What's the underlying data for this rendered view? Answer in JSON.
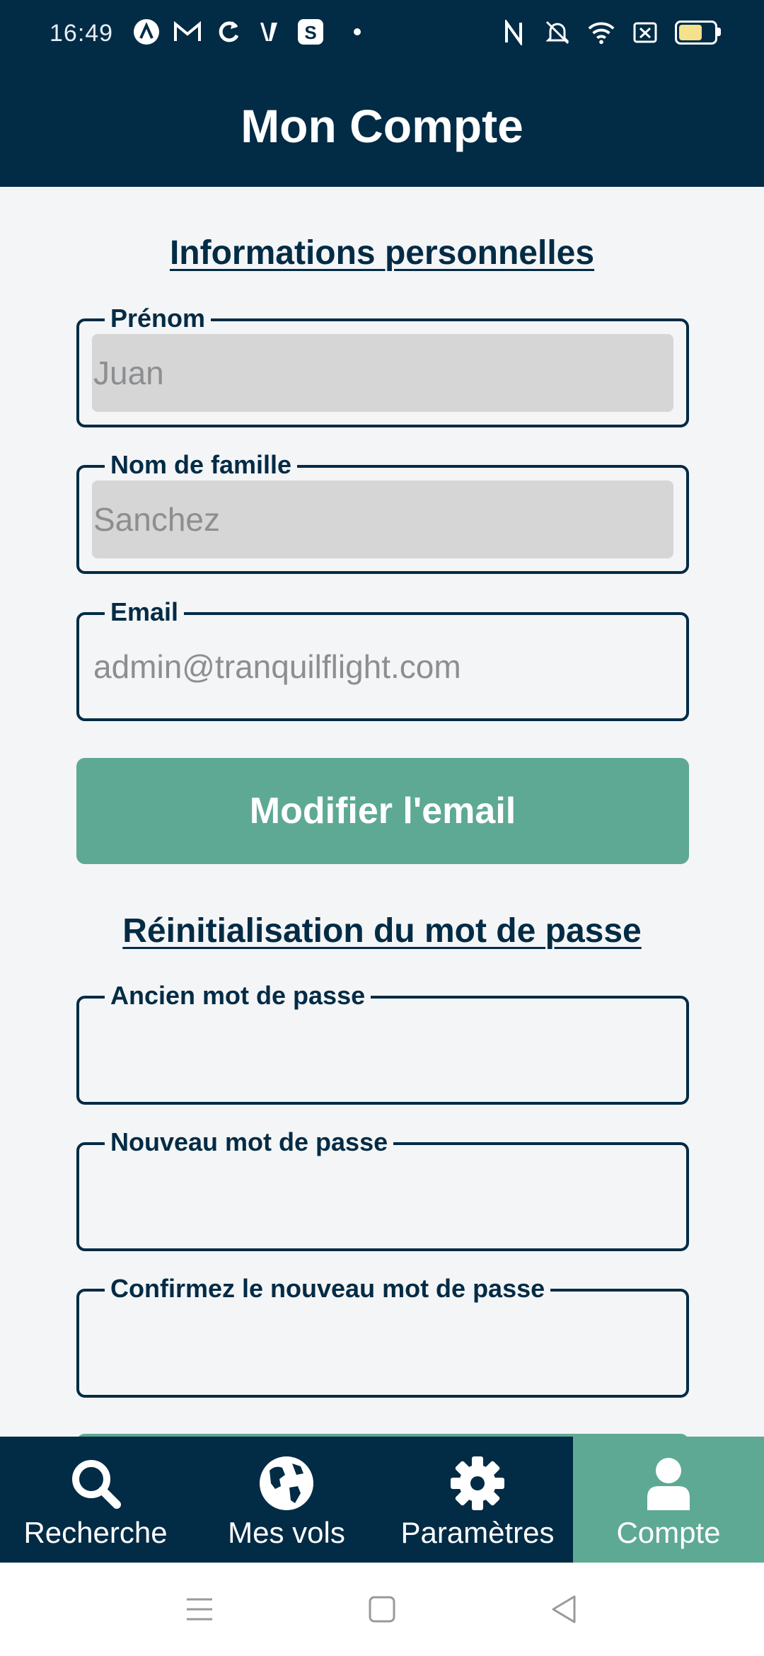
{
  "status_bar": {
    "time": "16:49",
    "notification_icons": [
      "app-a-icon",
      "gmail-icon",
      "sync-icon",
      "v-app-icon",
      "s-app-icon"
    ],
    "system_icons": [
      "nfc-icon",
      "mute-icon",
      "wifi-icon",
      "sim-icon",
      "battery-icon"
    ]
  },
  "header": {
    "title": "Mon Compte"
  },
  "personal": {
    "heading": "Informations personnelles",
    "first_name": {
      "label": "Prénom",
      "value": "Juan"
    },
    "last_name": {
      "label": "Nom de famille",
      "value": "Sanchez"
    },
    "email": {
      "label": "Email",
      "value": "admin@tranquilflight.com"
    },
    "change_email_button": "Modifier l'email"
  },
  "password": {
    "heading": "Réinitialisation du mot de passe",
    "old_password": {
      "label": "Ancien mot de passe",
      "value": ""
    },
    "new_password": {
      "label": "Nouveau mot de passe",
      "value": ""
    },
    "confirm_password": {
      "label": "Confirmez le nouveau mot de passe",
      "value": ""
    }
  },
  "bottom_nav": {
    "items": [
      {
        "label": "Recherche",
        "icon": "search-icon"
      },
      {
        "label": "Mes vols",
        "icon": "globe-icon"
      },
      {
        "label": "Paramètres",
        "icon": "gear-icon"
      },
      {
        "label": "Compte",
        "icon": "user-icon",
        "active": true
      }
    ]
  },
  "colors": {
    "primary": "#022b45",
    "accent": "#5ea994",
    "background": "#f4f5f6",
    "disabled_field": "#d6d6d6"
  }
}
